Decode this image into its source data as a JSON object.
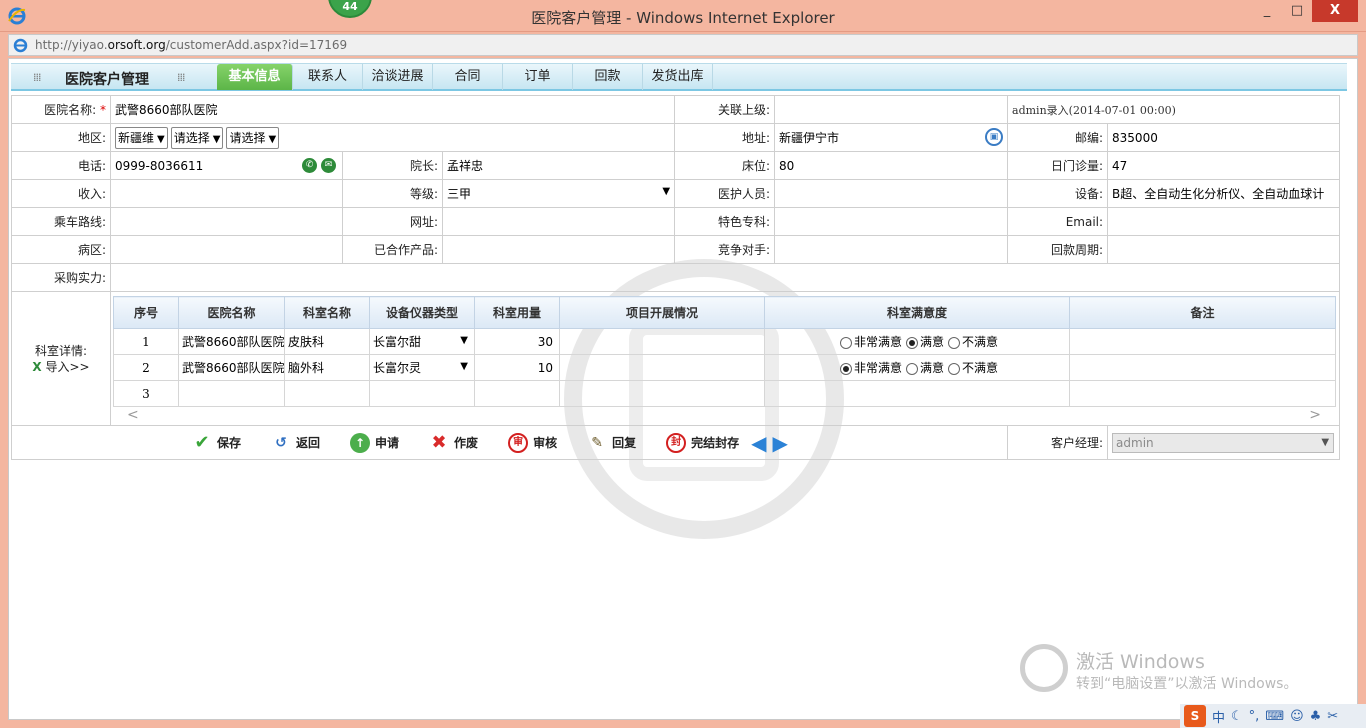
{
  "window": {
    "title": "医院客户管理 - Windows Internet Explorer",
    "badge": "44",
    "minimize": "_",
    "maximize": "□",
    "close": "X"
  },
  "address": {
    "url_prefix": "http://yiyao.",
    "url_domain": "orsoft.org",
    "url_suffix": "/customerAdd.aspx?id=17169"
  },
  "nav": {
    "app_title": "医院客户管理",
    "tabs": [
      "基本信息",
      "联系人",
      "洽谈进展",
      "合同",
      "订单",
      "回款",
      "发货出库"
    ],
    "active_tab": "基本信息"
  },
  "form": {
    "hospital_name_label": "医院名称:",
    "required_mark": "*",
    "hospital_name": "武警8660部队医院",
    "parent_label": "关联上级:",
    "parent_value": "",
    "entry_note": "admin录入(2014-07-01 00:00)",
    "region_label": "地区:",
    "region_1": "新疆维",
    "region_2": "请选择",
    "region_3": "请选择",
    "address_label": "地址:",
    "address_value": "新疆伊宁市",
    "zip_label": "邮编:",
    "zip_value": "835000",
    "phone_label": "电话:",
    "phone_value": "0999-8036611",
    "director_label": "院长:",
    "director_value": "孟祥忠",
    "beds_label": "床位:",
    "beds_value": "80",
    "daily_visits_label": "日门诊量:",
    "daily_visits_value": "47",
    "income_label": "收入:",
    "income_value": "",
    "grade_label": "等级:",
    "grade_value": "三甲",
    "medical_staff_label": "医护人员:",
    "medical_staff_value": "",
    "equipment_label": "设备:",
    "equipment_value": "B超、全自动生化分析仪、全自动血球计",
    "route_label": "乘车路线:",
    "route_value": "",
    "website_label": "网址:",
    "website_value": "",
    "specialty_label": "特色专科:",
    "specialty_value": "",
    "email_label": "Email:",
    "email_value": "",
    "ward_label": "病区:",
    "ward_value": "",
    "products_label": "已合作产品:",
    "products_value": "",
    "competitor_label": "竞争对手:",
    "competitor_value": "",
    "payback_label": "回款周期:",
    "payback_value": "",
    "purchase_power_label": "采购实力:",
    "purchase_power_value": "",
    "dept_detail_label": "科室详情:",
    "import_label": "导入>>"
  },
  "detail": {
    "headers": [
      "序号",
      "医院名称",
      "科室名称",
      "设备仪器类型",
      "科室用量",
      "项目开展情况",
      "科室满意度",
      "备注"
    ],
    "satisfaction_options": [
      "非常满意",
      "满意",
      "不满意"
    ],
    "rows": [
      {
        "no": "1",
        "hospital": "武警8660部队医院",
        "dept": "皮肤科",
        "device": "长富尔甜",
        "usage": "30",
        "progress": "",
        "satisfaction": "满意",
        "note": ""
      },
      {
        "no": "2",
        "hospital": "武警8660部队医院",
        "dept": "脑外科",
        "device": "长富尔灵",
        "usage": "10",
        "progress": "",
        "satisfaction": "非常满意",
        "note": ""
      },
      {
        "no": "3",
        "hospital": "",
        "dept": "",
        "device": "",
        "usage": "",
        "progress": "",
        "satisfaction": "",
        "note": ""
      }
    ]
  },
  "actions": {
    "save": "保存",
    "back": "返回",
    "apply": "申请",
    "void": "作废",
    "review": "审核",
    "reply": "回复",
    "seal": "完结封存",
    "manager_label": "客户经理:",
    "manager_value": "admin"
  },
  "activation": {
    "line1": "激活 Windows",
    "line2": "转到“电脑设置”以激活 Windows。"
  },
  "tray": {
    "ime": "S",
    "lang": "中"
  }
}
